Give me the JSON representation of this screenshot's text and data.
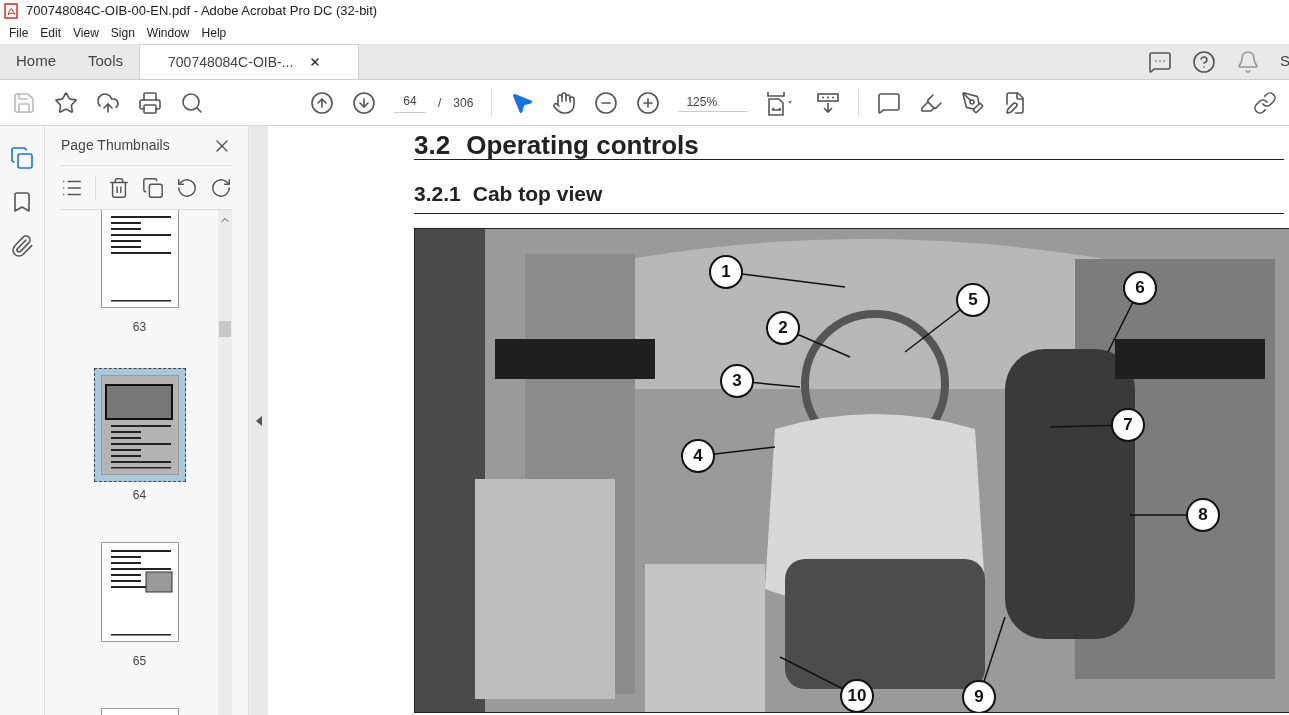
{
  "window": {
    "title": "700748084C-OIB-00-EN.pdf - Adobe Acrobat Pro DC (32-bit)"
  },
  "menu": [
    "File",
    "Edit",
    "View",
    "Sign",
    "Window",
    "Help"
  ],
  "tabs": [
    {
      "label": "Home",
      "selected": false
    },
    {
      "label": "Tools",
      "selected": false
    },
    {
      "label": "700748084C-OIB-...",
      "selected": true
    }
  ],
  "account_initial": "S",
  "toolbar": {
    "page_current": "64",
    "page_separator": "/",
    "page_total": "306",
    "zoom": "125%"
  },
  "sidebar": {
    "title": "Page Thumbnails",
    "thumbnails": [
      {
        "page": "63",
        "selected": false
      },
      {
        "page": "64",
        "selected": true
      },
      {
        "page": "65",
        "selected": false
      },
      {
        "selected": false
      }
    ]
  },
  "document": {
    "heading_number": "3.2",
    "heading": "Operating controls",
    "subheading_number": "3.2.1",
    "subheading": "Cab top view",
    "figure": {
      "kind": "picture",
      "callouts": [
        "1",
        "2",
        "3",
        "4",
        "5",
        "6",
        "7",
        "8",
        "9",
        "10"
      ]
    }
  }
}
